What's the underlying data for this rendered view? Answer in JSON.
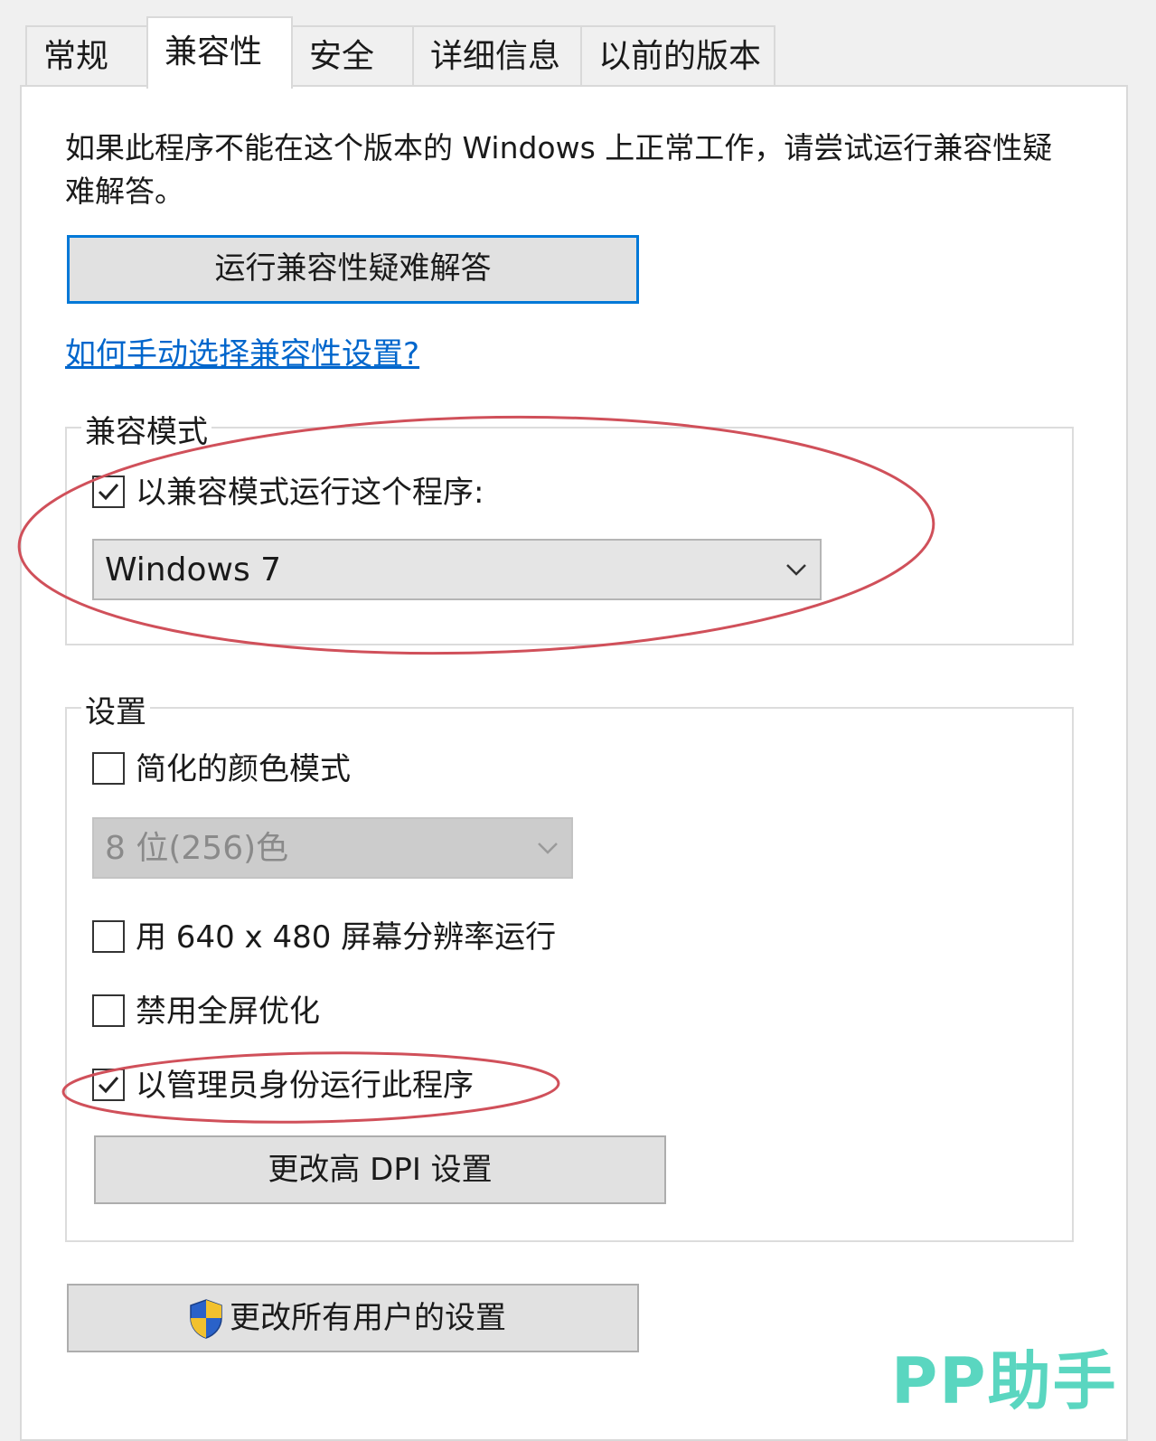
{
  "tabs": [
    {
      "label": "常规"
    },
    {
      "label": "兼容性"
    },
    {
      "label": "安全"
    },
    {
      "label": "详细信息"
    },
    {
      "label": "以前的版本"
    }
  ],
  "active_tab": "兼容性",
  "intro_text": "如果此程序不能在这个版本的 Windows 上正常工作，请尝试运行兼容性疑难解答。",
  "troubleshoot_button": "运行兼容性疑难解答",
  "help_link": "如何手动选择兼容性设置?",
  "compat_mode": {
    "legend": "兼容模式",
    "checkbox_label": "以兼容模式运行这个程序:",
    "checked": true,
    "selected_os": "Windows 7"
  },
  "settings": {
    "legend": "设置",
    "reduced_color": {
      "label": "简化的颜色模式",
      "checked": false
    },
    "color_select": "8 位(256)色",
    "res_640": {
      "label": "用 640 x 480 屏幕分辨率运行",
      "checked": false
    },
    "disable_fullscreen": {
      "label": "禁用全屏优化",
      "checked": false
    },
    "run_as_admin": {
      "label": "以管理员身份运行此程序",
      "checked": true
    },
    "dpi_button": "更改高 DPI 设置"
  },
  "all_users_button": "更改所有用户的设置",
  "watermark": "PP助手",
  "colors": {
    "accent": "#0078d7",
    "link": "#0066cc",
    "annotation": "#d0505a",
    "watermark": "#5ad6c0"
  }
}
